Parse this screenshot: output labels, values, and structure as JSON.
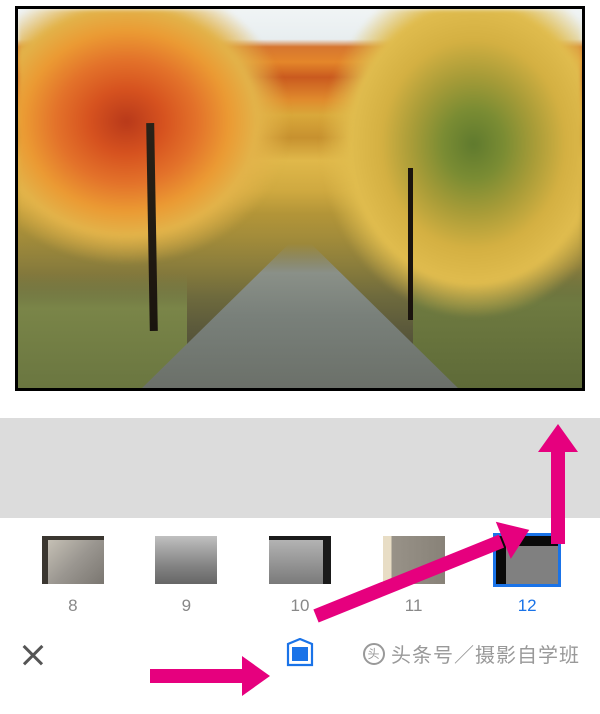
{
  "filmstrip": {
    "items": [
      {
        "label": "8",
        "selected": false
      },
      {
        "label": "9",
        "selected": false
      },
      {
        "label": "10",
        "selected": false
      },
      {
        "label": "11",
        "selected": false
      },
      {
        "label": "12",
        "selected": true
      }
    ]
  },
  "toolbar": {
    "close_label": "",
    "frame_tool_label": ""
  },
  "watermark": {
    "text": "头条号／摄影自学班"
  },
  "colors": {
    "accent": "#1a73e8",
    "annotation": "#e6007e"
  }
}
